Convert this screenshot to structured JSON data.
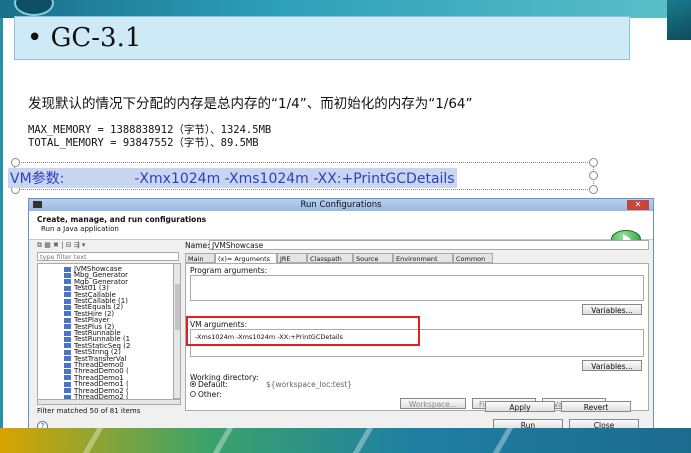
{
  "slide": {
    "title": "• GC-3.1",
    "description": "发现默认的情况下分配的内存是总内存的“1/4”、而初始化的内存为“1/64”",
    "max_memory_line": "MAX_MEMORY = 1388838912（字节）、1324.5MB",
    "total_memory_line": "TOTAL_MEMORY = 93847552（字节）、89.5MB",
    "vm_params": "VM参数:　　　　　-Xmx1024m -Xms1024m -XX:+PrintGCDetails"
  },
  "dialog": {
    "title": "Run Configurations",
    "close_label": "✕",
    "header_title": "Create, manage, and run configurations",
    "header_subtitle": "Run a Java application",
    "filter_placeholder": "type filter text",
    "toolbar_icons": "⧉ ▦ ✖ | ⊟ ⇶ ▾",
    "tree_items": [
      "JVMShowcase",
      "Mbg_Generator",
      "Mgb_Generator",
      "Test01 (3)",
      "TestCallable",
      "TestCallable (1)",
      "TestEquals (2)",
      "TestHire (2)",
      "TestPlayer",
      "TestPlus (2)",
      "TestRunnable",
      "TestRunnable (1",
      "TestStaticSeq (2",
      "TestString (2)",
      "TestTransferVal",
      "ThreadDemo0",
      "ThreadDemo0 (",
      "ThreadDemo1",
      "ThreadDemo1 (",
      "ThreadDemo2 (",
      "ThreadDemo2 ("
    ],
    "filter_status": "Filter matched 50 of 81 items",
    "name_label": "Name:",
    "name_value": "JVMShowcase",
    "tabs": [
      "Main",
      "(x)= Arguments",
      "JRE",
      "Classpath",
      "Source",
      "Environment",
      "Common"
    ],
    "program_args_label": "Program arguments:",
    "variables_label": "Variables...",
    "vm_args_label": "VM arguments:",
    "vm_args_value": "-Xms1024m -Xms1024m -XX:+PrintGCDetails",
    "working_dir_label": "Working directory:",
    "default_label": "Default:",
    "default_value": "${workspace_loc:test}",
    "other_label": "Other:",
    "workspace_btn": "Workspace...",
    "filesystem_btn": "File System...",
    "variables_btn": "Variables...",
    "apply_btn": "Apply",
    "revert_btn": "Revert",
    "run_btn": "Run",
    "close_btn": "Close",
    "help_label": "?"
  }
}
